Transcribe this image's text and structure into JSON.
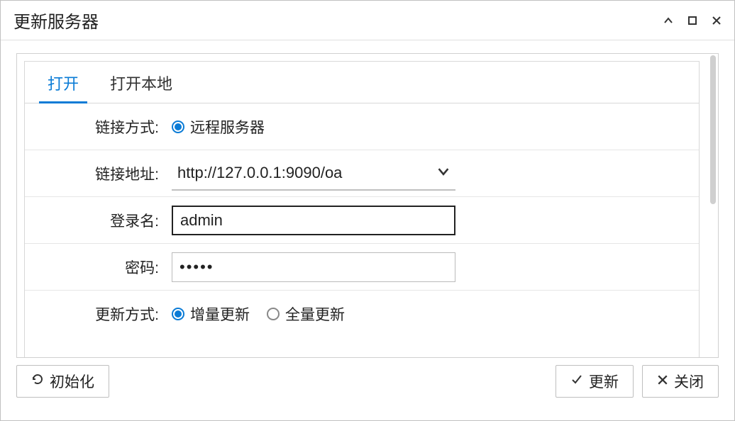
{
  "window": {
    "title": "更新服务器"
  },
  "tabs": {
    "open": "打开",
    "open_local": "打开本地"
  },
  "form": {
    "connect_type_label": "链接方式:",
    "connect_type_option_remote": "远程服务器",
    "connect_addr_label": "链接地址:",
    "connect_addr_value": "http://127.0.0.1:9090/oa",
    "login_name_label": "登录名:",
    "login_name_value": "admin",
    "password_label": "密码:",
    "password_value": "•••••",
    "update_type_label": "更新方式:",
    "update_type_incremental": "增量更新",
    "update_type_full": "全量更新"
  },
  "buttons": {
    "initialize": "初始化",
    "update": "更新",
    "close": "关闭"
  }
}
